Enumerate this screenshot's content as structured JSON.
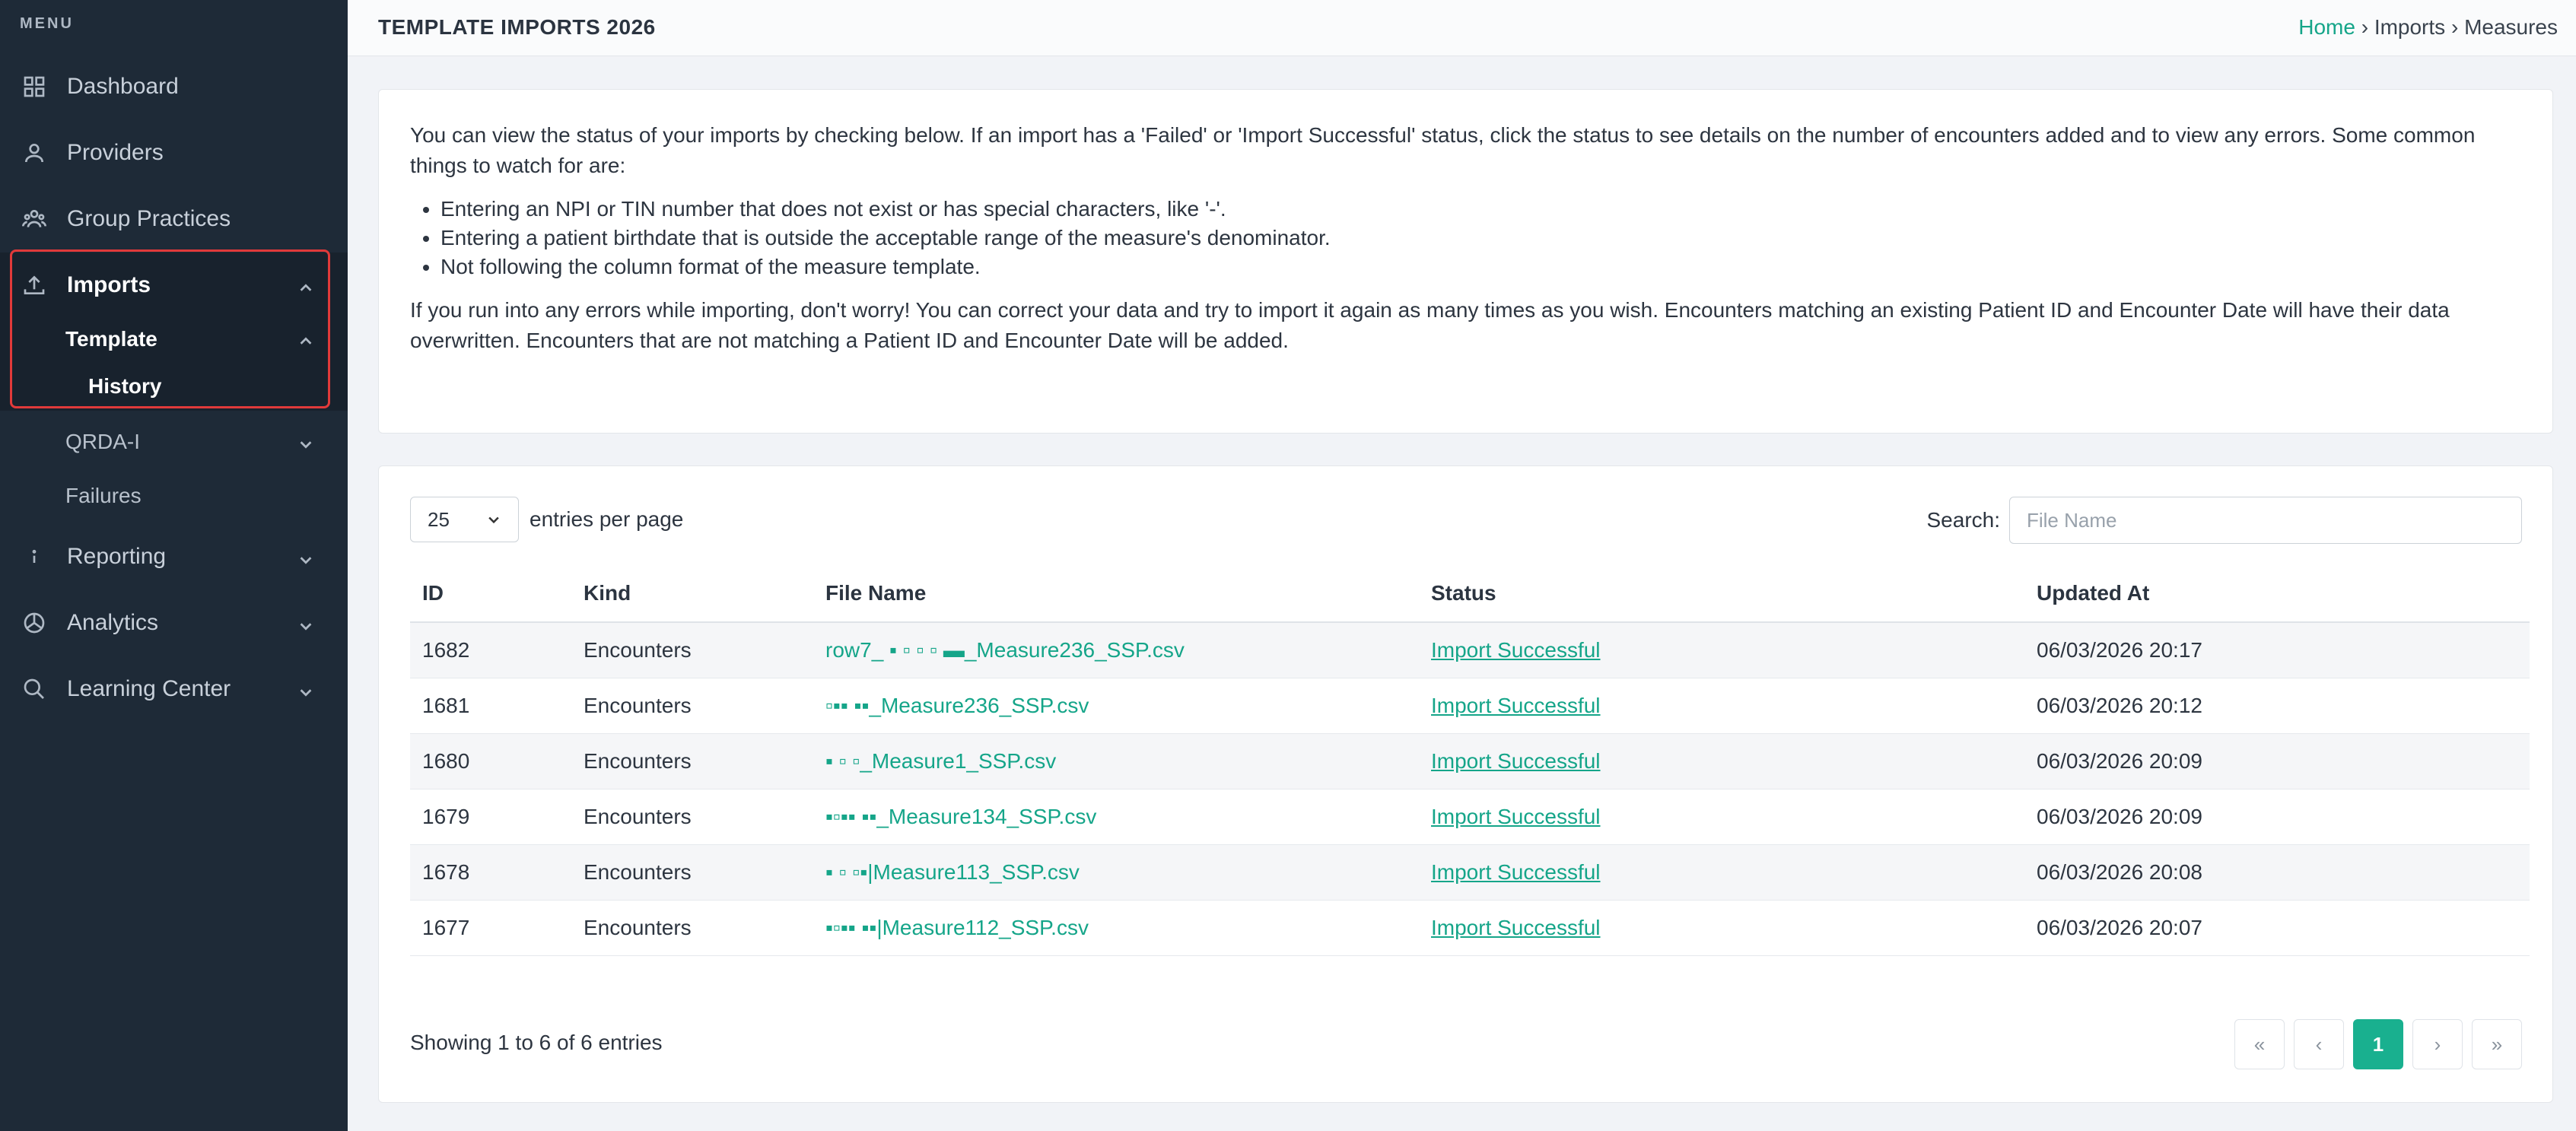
{
  "sidebar": {
    "menu_label": "MENU",
    "items": {
      "dashboard": "Dashboard",
      "providers": "Providers",
      "group_practices": "Group Practices",
      "imports": "Imports",
      "template": "Template",
      "history": "History",
      "qrda": "QRDA-I",
      "failures": "Failures",
      "reporting": "Reporting",
      "analytics": "Analytics",
      "learning_center": "Learning Center"
    }
  },
  "header": {
    "title": "TEMPLATE IMPORTS 2026",
    "breadcrumb": {
      "home": "Home",
      "sep1": " › ",
      "imports": "Imports",
      "sep2": " › ",
      "measures": "Measures"
    }
  },
  "intro": {
    "para1": "You can view the status of your imports by checking below. If an import has a 'Failed' or 'Import Successful' status, click the status to see details on the number of encounters added and to view any errors. Some common things to watch for are:",
    "bullets": [
      "Entering an NPI or TIN number that does not exist or has special characters, like '-'.",
      "Entering a patient birthdate that is outside the acceptable range of the measure's denominator.",
      "Not following the column format of the measure template."
    ],
    "para2": "If you run into any errors while importing, don't worry! You can correct your data and try to import it again as many times as you wish. Encounters matching an existing Patient ID and Encounter Date will have their data overwritten. Encounters that are not matching a Patient ID and Encounter Date will be added."
  },
  "controls": {
    "page_size": "25",
    "entries_label": "entries per page",
    "search_label": "Search:",
    "search_placeholder": "File Name"
  },
  "table": {
    "headers": {
      "id": "ID",
      "kind": "Kind",
      "file": "File Name",
      "status": "Status",
      "updated": "Updated At"
    },
    "rows": [
      {
        "id": "1682",
        "kind": "Encounters",
        "file": "row7_ ▪ ▫ ▫ ▫ ▬_Measure236_SSP.csv",
        "status": "Import Successful",
        "updated": "06/03/2026 20:17"
      },
      {
        "id": "1681",
        "kind": "Encounters",
        "file": "▫▪▪  ▪▪_Measure236_SSP.csv",
        "status": "Import Successful",
        "updated": "06/03/2026 20:12"
      },
      {
        "id": "1680",
        "kind": "Encounters",
        "file": "▪  ▫   ▫_Measure1_SSP.csv",
        "status": "Import Successful",
        "updated": "06/03/2026 20:09"
      },
      {
        "id": "1679",
        "kind": "Encounters",
        "file": "▪▫▪▪  ▪▪_Measure134_SSP.csv",
        "status": "Import Successful",
        "updated": "06/03/2026 20:09"
      },
      {
        "id": "1678",
        "kind": "Encounters",
        "file": "▪   ▫    ▫▪|Measure113_SSP.csv",
        "status": "Import Successful",
        "updated": "06/03/2026 20:08"
      },
      {
        "id": "1677",
        "kind": "Encounters",
        "file": "▪▫▪▪  ▪▪|Measure112_SSP.csv",
        "status": "Import Successful",
        "updated": "06/03/2026 20:07"
      }
    ]
  },
  "footer": {
    "info": "Showing 1 to 6 of 6 entries",
    "pager": {
      "first": "«",
      "prev": "‹",
      "current": "1",
      "next": "›",
      "last": "»"
    }
  },
  "colors": {
    "accent": "#15a589",
    "sidebar_bg": "#1e2a37",
    "highlight": "#e03a3a"
  }
}
